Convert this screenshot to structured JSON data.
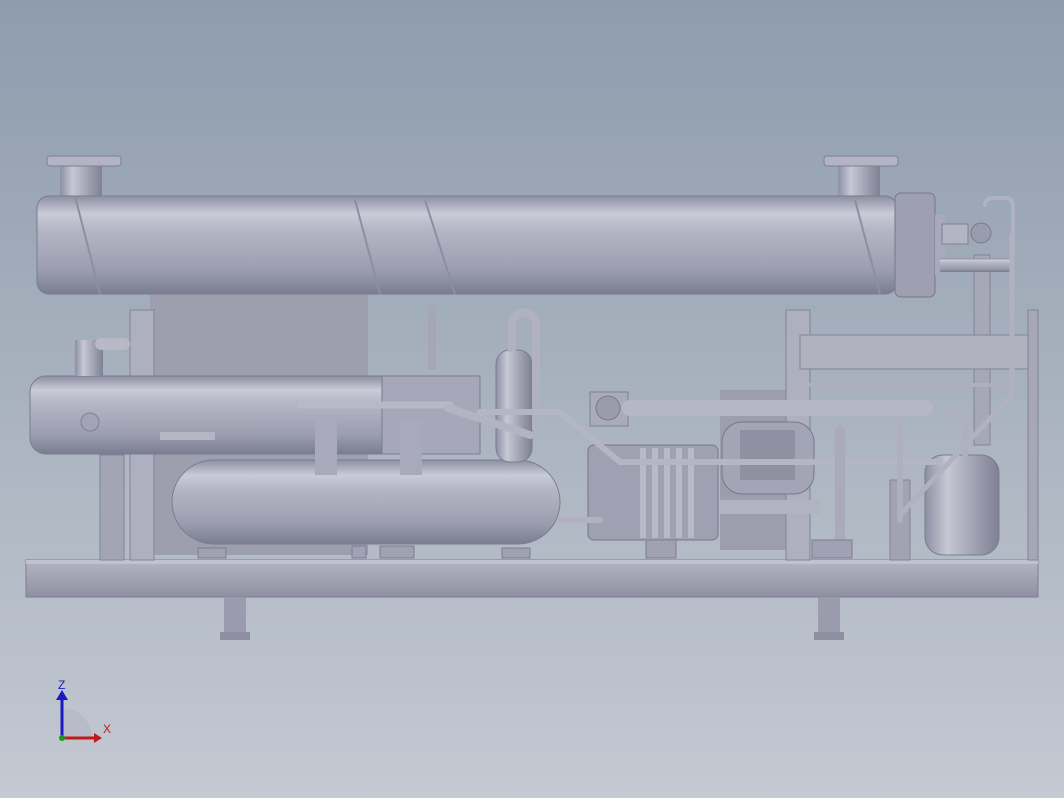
{
  "viewport": {
    "background_top": "#8e9cae",
    "background_bottom": "#c4c9d2",
    "model_color": "#a9abbb"
  },
  "triad": {
    "z_label": "Z",
    "x_label": "X",
    "z_color": "#1a1ac0",
    "x_color": "#c01a1a",
    "y_color": "#1a9a1a"
  }
}
